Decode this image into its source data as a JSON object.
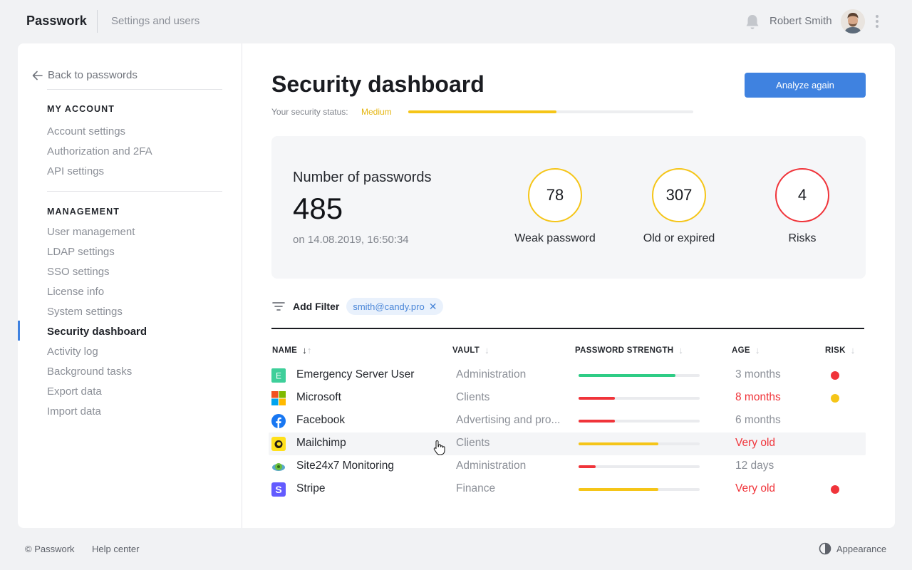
{
  "topbar": {
    "brand": "Passwork",
    "section": "Settings and users",
    "user_name": "Robert Smith",
    "icons": [
      "bell-icon",
      "avatar",
      "kebab-menu-icon"
    ]
  },
  "sidebar": {
    "back_label": "Back to passwords",
    "account_heading": "MY ACCOUNT",
    "account_items": [
      "Account settings",
      "Authorization and 2FA",
      "API settings"
    ],
    "management_heading": "MANAGEMENT",
    "management_items": [
      "User management",
      "LDAP settings",
      "SSO settings",
      "License info",
      "System settings",
      "Security dashboard",
      "Activity log",
      "Background tasks",
      "Export data",
      "Import data"
    ],
    "active_item": "Security dashboard"
  },
  "main": {
    "title": "Security dashboard",
    "analyze_label": "Analyze again",
    "status_label": "Your security status:",
    "status_value": "Medium",
    "status_level": 0.52,
    "summary": {
      "label": "Number of passwords",
      "count": "485",
      "date": "on 14.08.2019, 16:50:34"
    },
    "metrics": [
      {
        "value": "78",
        "label": "Weak password",
        "color": "#f5c518"
      },
      {
        "value": "307",
        "label": "Old or expired",
        "color": "#f5c518"
      },
      {
        "value": "4",
        "label": "Risks",
        "color": "#f0343a"
      }
    ],
    "filter": {
      "label": "Add Filter",
      "chip": "smith@candy.pro"
    },
    "columns": {
      "name": "NAME",
      "vault": "VAULT",
      "strength": "PASSWORD STRENGTH",
      "age": "AGE",
      "risk": "RISK"
    },
    "rows": [
      {
        "name": "Emergency Server User",
        "icon": "emergency-server-icon",
        "vault": "Administration",
        "strength": 0.8,
        "strength_color": "#2ecc85",
        "age": "3 months",
        "age_warn": false,
        "risk_color": "#f0343a"
      },
      {
        "name": "Microsoft",
        "icon": "microsoft-icon",
        "vault": "Clients",
        "strength": 0.3,
        "strength_color": "#f0343a",
        "age": "8 months",
        "age_warn": true,
        "risk_color": "#f5c518"
      },
      {
        "name": "Facebook",
        "icon": "facebook-icon",
        "vault": "Advertising and pro...",
        "strength": 0.3,
        "strength_color": "#f0343a",
        "age": "6 months",
        "age_warn": false,
        "risk_color": ""
      },
      {
        "name": "Mailchimp",
        "icon": "mailchimp-icon",
        "vault": "Clients",
        "strength": 0.66,
        "strength_color": "#f5c518",
        "age": "Very old",
        "age_warn": true,
        "risk_color": ""
      },
      {
        "name": "Site24x7 Monitoring",
        "icon": "site24x7-icon",
        "vault": "Administration",
        "strength": 0.14,
        "strength_color": "#f0343a",
        "age": "12 days",
        "age_warn": false,
        "risk_color": ""
      },
      {
        "name": "Stripe",
        "icon": "stripe-icon",
        "vault": "Finance",
        "strength": 0.66,
        "strength_color": "#f5c518",
        "age": "Very old",
        "age_warn": true,
        "risk_color": "#f0343a"
      }
    ]
  },
  "footer": {
    "copyright": "© Passwork",
    "help": "Help center",
    "appearance": "Appearance"
  },
  "colors": {
    "accent": "#3f82e0",
    "warning": "#f5c518",
    "danger": "#f0343a",
    "success": "#2ecc85"
  }
}
